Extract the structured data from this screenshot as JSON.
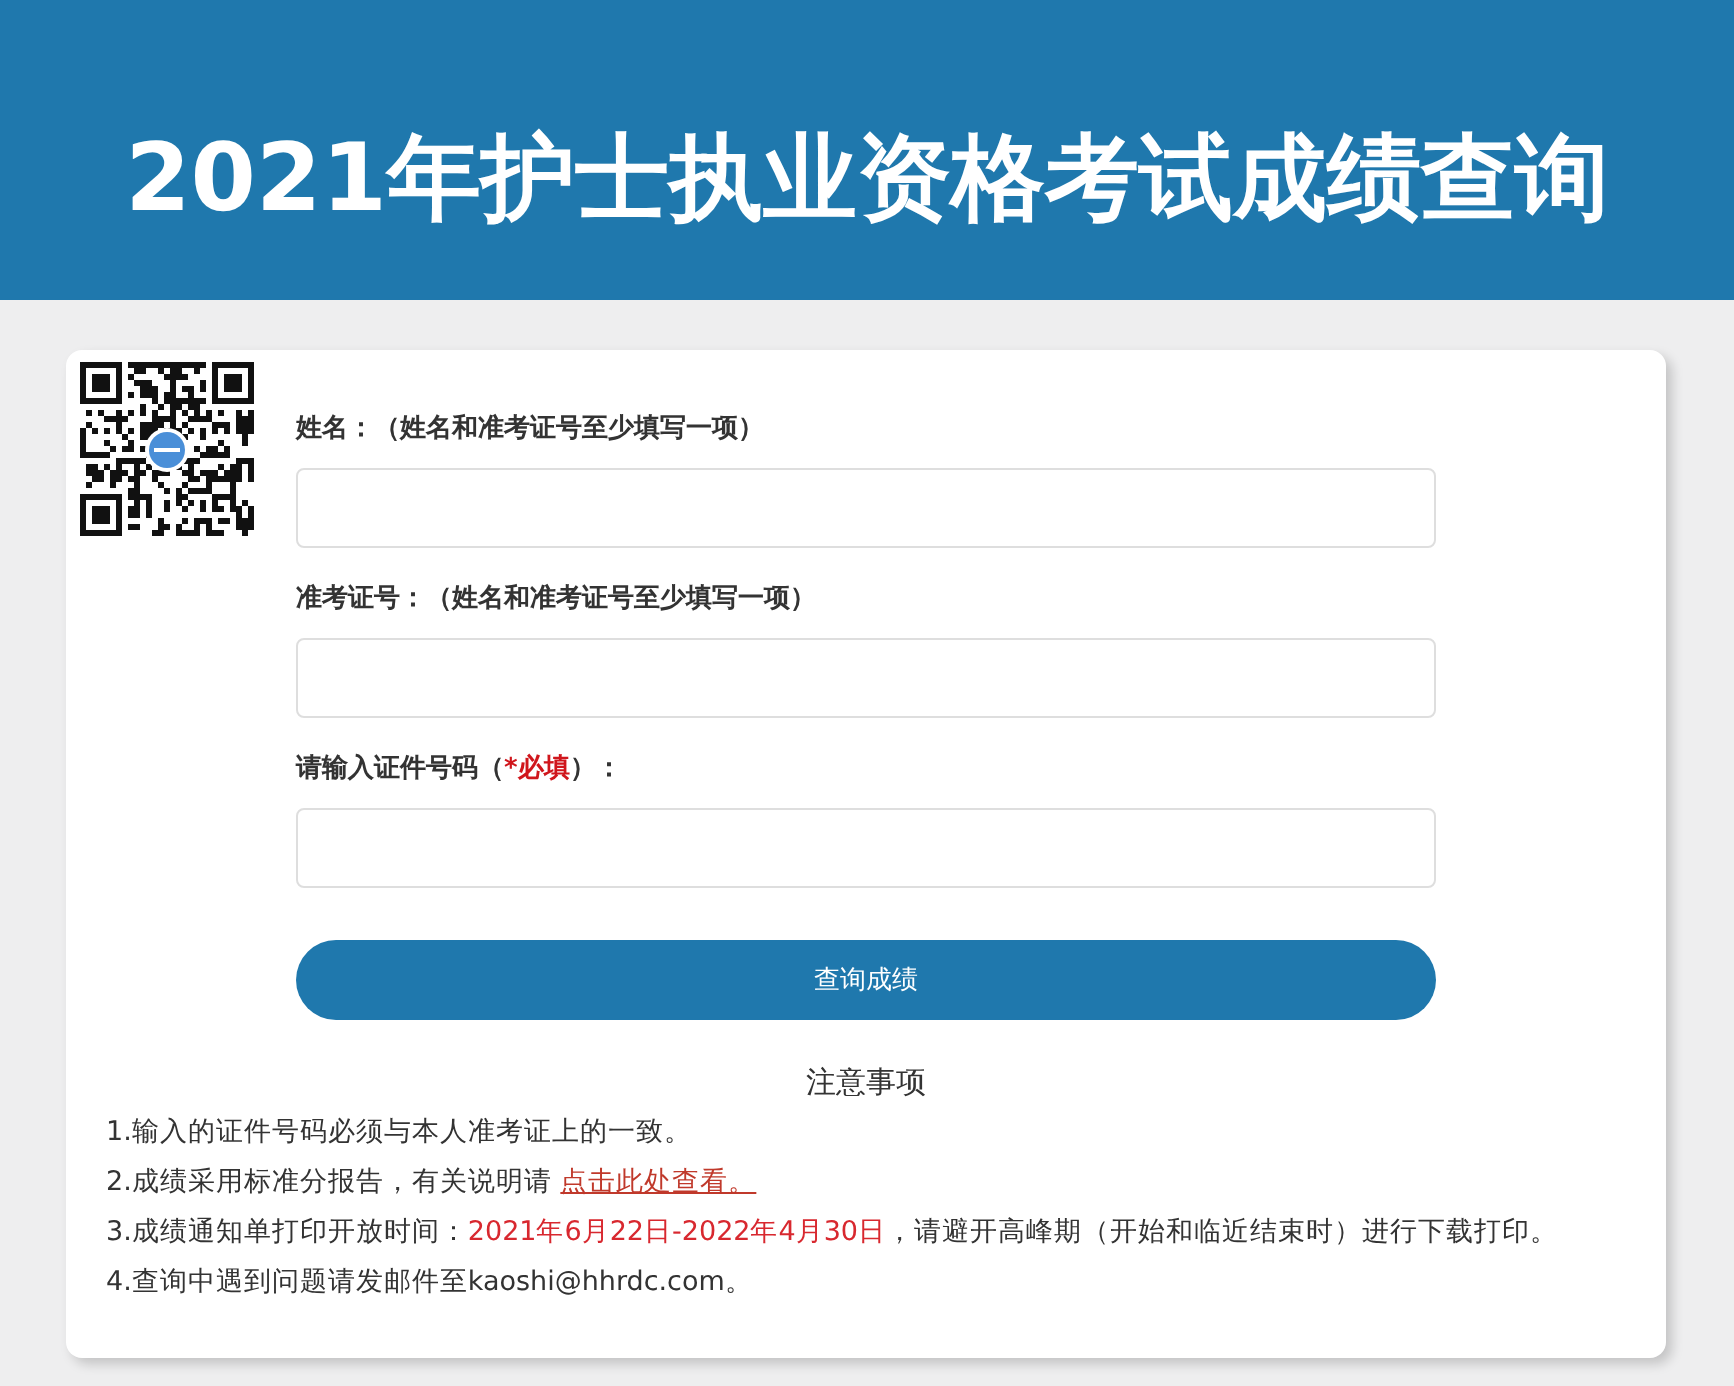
{
  "header": {
    "title": "2021年护士执业资格考试成绩查询"
  },
  "form": {
    "fields": [
      {
        "label": [
          {
            "kind": "text",
            "text": "姓名：（姓名和准考证号至少填写一项）"
          }
        ]
      },
      {
        "label": [
          {
            "kind": "text",
            "text": "准考证号：（姓名和准考证号至少填写一项）"
          }
        ]
      },
      {
        "label": [
          {
            "kind": "text",
            "text": "请输入证件号码（"
          },
          {
            "kind": "required",
            "text": "*必填"
          },
          {
            "kind": "text",
            "text": "）："
          }
        ]
      }
    ],
    "submit_button": "查询成绩"
  },
  "notice": {
    "heading": "注意事项",
    "items": [
      {
        "parts": [
          {
            "kind": "text",
            "text": "1.输入的证件号码必须与本人准考证上的一致。"
          }
        ]
      },
      {
        "parts": [
          {
            "kind": "text",
            "text": "2.成绩采用标准分报告，有关说明请 "
          },
          {
            "kind": "link",
            "text": "点击此处查看。"
          }
        ]
      },
      {
        "parts": [
          {
            "kind": "text",
            "text": "3.成绩通知单打印开放时间："
          },
          {
            "kind": "highlight",
            "text": "2021年6月22日-2022年4月30日"
          },
          {
            "kind": "text",
            "text": "，请避开高峰期（开始和临近结束时）进行下载打印。"
          }
        ]
      },
      {
        "parts": [
          {
            "kind": "text",
            "text": "4.查询中遇到问题请发邮件至kaoshi@hhrdc.com。"
          }
        ]
      }
    ]
  }
}
